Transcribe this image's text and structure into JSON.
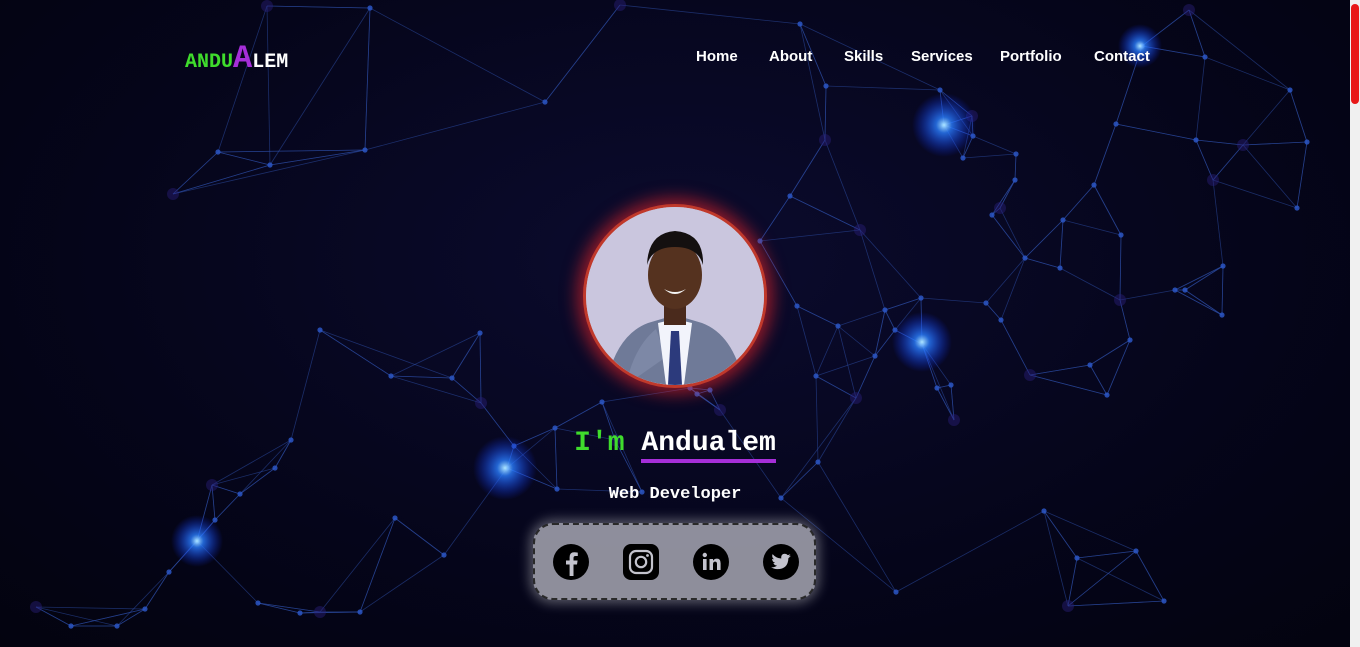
{
  "logo": {
    "part1": "ANDU",
    "part2": "A",
    "part3": "LEM"
  },
  "nav": {
    "items": [
      "Home",
      "About",
      "Skills",
      "Services",
      "Portfolio",
      "Contact"
    ]
  },
  "hero": {
    "greeting": "I'm",
    "name": "Andualem",
    "role": "Web Developer"
  },
  "social": [
    "facebook-icon",
    "instagram-icon",
    "linkedin-icon",
    "twitter-icon"
  ],
  "colors": {
    "accent_green": "#3fdc2c",
    "accent_purple": "#a52ed8",
    "glow_red": "#c0392b",
    "background": "#05051a"
  }
}
